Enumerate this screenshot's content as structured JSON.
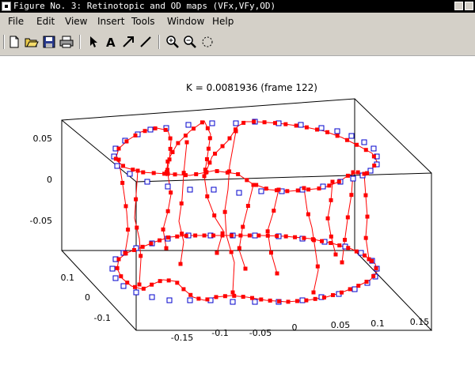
{
  "window": {
    "title": "Figure No. 3: Retinotopic and OD maps (VFx,VFy,OD)"
  },
  "menu": [
    "File",
    "Edit",
    "View",
    "Insert",
    "Tools",
    "Window",
    "Help"
  ],
  "toolbar": [
    "new-figure-icon",
    "open-file-icon",
    "save-icon",
    "print-icon",
    "edit-plot-arrow-icon",
    "insert-text-icon",
    "insert-arrow-icon",
    "insert-line-icon",
    "zoom-in-icon",
    "zoom-out-icon",
    "rotate-3d-icon"
  ],
  "colors": {
    "titlebar": "#000000",
    "chrome": "#d4d0c8",
    "curve": "#ff0000",
    "marker_edge": "#0000cc"
  },
  "chart_data": {
    "type": "scatter",
    "title": "K = 0.0081936 (frame 122)",
    "x_ticks": [
      "-0.15",
      "-0.1",
      "-0.05",
      "0",
      "0.05",
      "0.1",
      "0.15"
    ],
    "y_ticks": [
      "0.1",
      "0",
      "-0.1"
    ],
    "z_ticks": [
      "0.05",
      "0",
      "-0.05"
    ],
    "grid": false,
    "series": [
      {
        "marker": "red filled square",
        "line": "red solid"
      },
      {
        "marker": "blue open square",
        "line": "none"
      }
    ]
  }
}
